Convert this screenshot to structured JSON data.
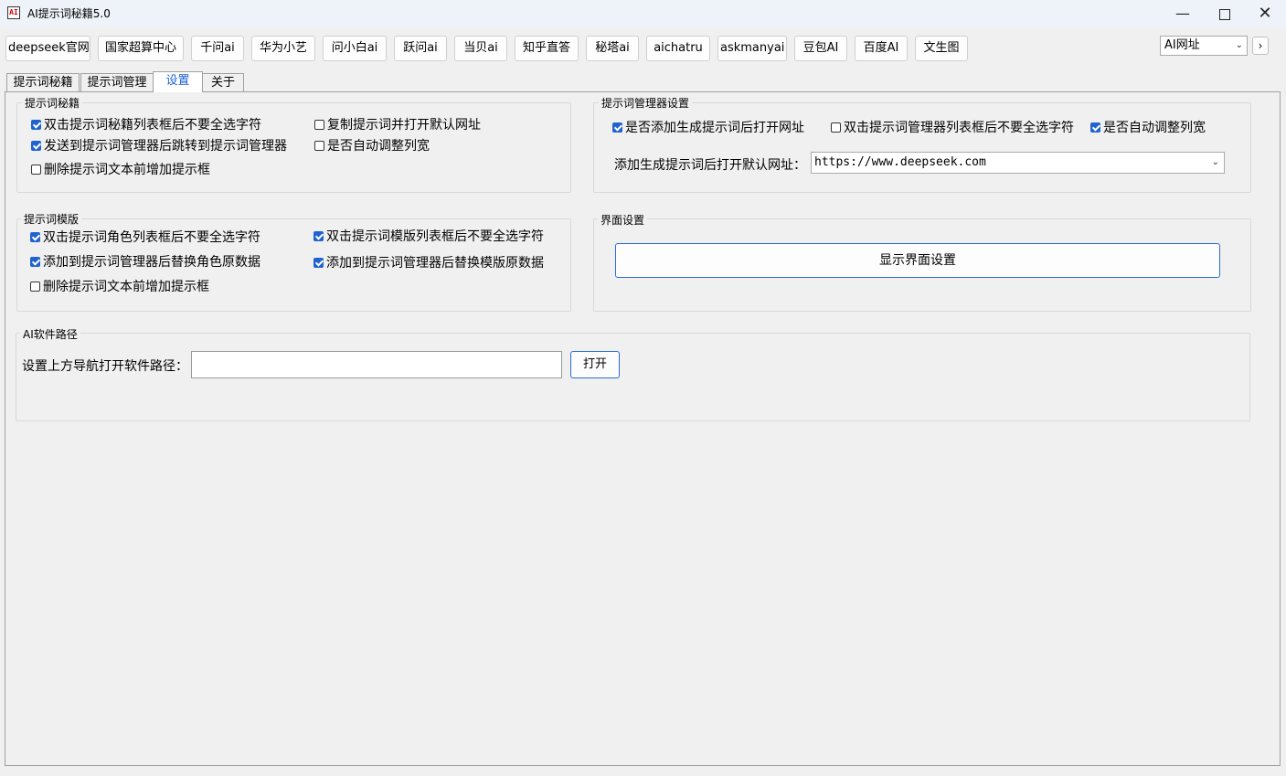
{
  "window": {
    "title": "AI提示词秘籍5.0",
    "icon_text": "AI"
  },
  "toolbar": {
    "buttons": [
      "deepseek官网",
      "国家超算中心",
      "千问ai",
      "华为小艺",
      "问小白ai",
      "跃问ai",
      "当贝ai",
      "知乎直答",
      "秘塔ai",
      "aichatru",
      "askmanyai",
      "豆包AI",
      "百度AI",
      "文生图"
    ],
    "site_select": "AI网址",
    "next_glyph": "›"
  },
  "tabs": [
    "提示词秘籍",
    "提示词管理",
    "设置",
    "关于"
  ],
  "active_tab": 2,
  "groups": {
    "secret": {
      "title": "提示词秘籍",
      "options": [
        {
          "label": "双击提示词秘籍列表框后不要全选字符",
          "checked": true
        },
        {
          "label": "复制提示词并打开默认网址",
          "checked": false
        },
        {
          "label": "发送到提示词管理器后跳转到提示词管理器",
          "checked": true
        },
        {
          "label": "是否自动调整列宽",
          "checked": false
        },
        {
          "label": "删除提示词文本前增加提示框",
          "checked": false
        }
      ]
    },
    "manager": {
      "title": "提示词管理器设置",
      "options": [
        {
          "label": "是否添加生成提示词后打开网址",
          "checked": true
        },
        {
          "label": "双击提示词管理器列表框后不要全选字符",
          "checked": false
        },
        {
          "label": "是否自动调整列宽",
          "checked": true
        }
      ],
      "url_label": "添加生成提示词后打开默认网址：",
      "url_value": "https://www.deepseek.com"
    },
    "template": {
      "title": "提示词模版",
      "options": [
        {
          "label": "双击提示词角色列表框后不要全选字符",
          "checked": true
        },
        {
          "label": "双击提示词模版列表框后不要全选字符",
          "checked": true
        },
        {
          "label": "添加到提示词管理器后替换角色原数据",
          "checked": true
        },
        {
          "label": "添加到提示词管理器后替换模版原数据",
          "checked": true
        },
        {
          "label": "删除提示词文本前增加提示框",
          "checked": false
        }
      ]
    },
    "ui": {
      "title": "界面设置",
      "button": "显示界面设置"
    },
    "software": {
      "title": "AI软件路径",
      "path_label": "设置上方导航打开软件路径：",
      "path_value": "",
      "open_button": "打开"
    }
  }
}
